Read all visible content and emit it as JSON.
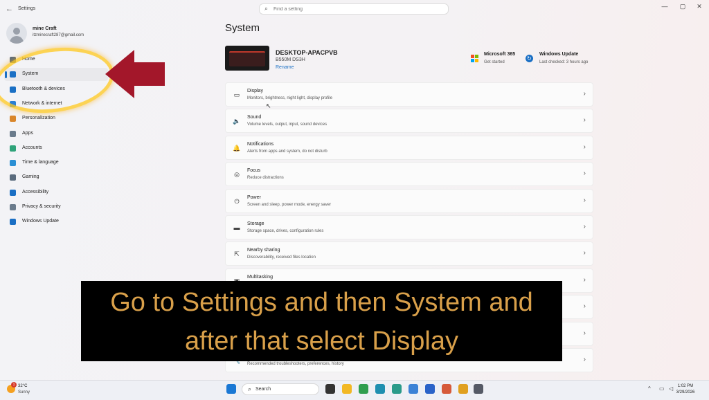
{
  "window": {
    "title": "Settings",
    "search_placeholder": "Find a setting",
    "minimize": "—",
    "maximize": "▢",
    "close": "✕"
  },
  "user": {
    "name": "mine Craft",
    "email": "itzminecraft287@gmail.com"
  },
  "sidebar": {
    "items": [
      {
        "label": "Home",
        "icon": "home-icon",
        "color": "#5a6b7d"
      },
      {
        "label": "System",
        "icon": "monitor-icon",
        "color": "#1a6fc4",
        "selected": true
      },
      {
        "label": "Bluetooth & devices",
        "icon": "bluetooth-icon",
        "color": "#1a6fc4"
      },
      {
        "label": "Network & internet",
        "icon": "wifi-icon",
        "color": "#2a7fd4"
      },
      {
        "label": "Personalization",
        "icon": "brush-icon",
        "color": "#d9862b"
      },
      {
        "label": "Apps",
        "icon": "apps-icon",
        "color": "#6a7b8c"
      },
      {
        "label": "Accounts",
        "icon": "person-icon",
        "color": "#2fa37a"
      },
      {
        "label": "Time & language",
        "icon": "globe-clock-icon",
        "color": "#2a8fd4"
      },
      {
        "label": "Gaming",
        "icon": "gamepad-icon",
        "color": "#5a6b7d"
      },
      {
        "label": "Accessibility",
        "icon": "accessibility-icon",
        "color": "#1a6fc4"
      },
      {
        "label": "Privacy & security",
        "icon": "shield-icon",
        "color": "#6a7b8c"
      },
      {
        "label": "Windows Update",
        "icon": "update-icon",
        "color": "#1a6fc4"
      }
    ]
  },
  "main": {
    "title": "System",
    "device": {
      "name": "DESKTOP-APACPVB",
      "model": "B550M DS3H",
      "rename": "Rename"
    },
    "quick": [
      {
        "title": "Microsoft 365",
        "subtitle": "Get started"
      },
      {
        "title": "Windows Update",
        "subtitle": "Last checked: 3 hours ago"
      }
    ],
    "rows": [
      {
        "title": "Display",
        "subtitle": "Monitors, brightness, night light, display profile",
        "icon": "display-icon",
        "glyph": "▭"
      },
      {
        "title": "Sound",
        "subtitle": "Volume levels, output, input, sound devices",
        "icon": "speaker-icon",
        "glyph": "🔈"
      },
      {
        "title": "Notifications",
        "subtitle": "Alerts from apps and system, do not disturb",
        "icon": "bell-icon",
        "glyph": "🔔"
      },
      {
        "title": "Focus",
        "subtitle": "Reduce distractions",
        "icon": "focus-icon",
        "glyph": "◎"
      },
      {
        "title": "Power",
        "subtitle": "Screen and sleep, power mode, energy saver",
        "icon": "power-icon",
        "glyph": "⏻"
      },
      {
        "title": "Storage",
        "subtitle": "Storage space, drives, configuration rules",
        "icon": "storage-icon",
        "glyph": "▬"
      },
      {
        "title": "Nearby sharing",
        "subtitle": "Discoverability, received files location",
        "icon": "share-icon",
        "glyph": "⇱"
      },
      {
        "title": "Multitasking",
        "subtitle": "",
        "icon": "multitask-icon",
        "glyph": "▣"
      },
      {
        "title": "",
        "subtitle": "",
        "icon": "settings-row-icon",
        "glyph": ""
      },
      {
        "title": "",
        "subtitle": "",
        "icon": "settings-row-icon",
        "glyph": ""
      },
      {
        "title": "",
        "subtitle": "Recommended troubleshooters, preferences, history",
        "icon": "wrench-icon",
        "glyph": "🔧"
      }
    ]
  },
  "caption": {
    "line1": "Go to Settings and then System and",
    "line2": "after that select Display"
  },
  "taskbar": {
    "weather_temp": "32°C",
    "weather_cond": "Sunny",
    "weather_badge": "1",
    "search_label": "Search",
    "time": "1:02 PM",
    "date": "3/29/2026",
    "apps": [
      {
        "name": "start-icon",
        "color": "#1a78d4"
      },
      {
        "name": "task-view-icon",
        "color": "#333333"
      },
      {
        "name": "file-explorer-icon",
        "color": "#f2b824"
      },
      {
        "name": "chrome-icon",
        "color": "#2f9e4f"
      },
      {
        "name": "edge-icon",
        "color": "#1e8fb0"
      },
      {
        "name": "edge-beta-icon",
        "color": "#2a9b8a"
      },
      {
        "name": "photos-icon",
        "color": "#3b82d6"
      },
      {
        "name": "store-icon",
        "color": "#2a63c8"
      },
      {
        "name": "paint-icon",
        "color": "#d65a3a"
      },
      {
        "name": "chrome-dev-icon",
        "color": "#e0a020"
      },
      {
        "name": "settings-app-icon",
        "color": "#555a66"
      }
    ]
  }
}
